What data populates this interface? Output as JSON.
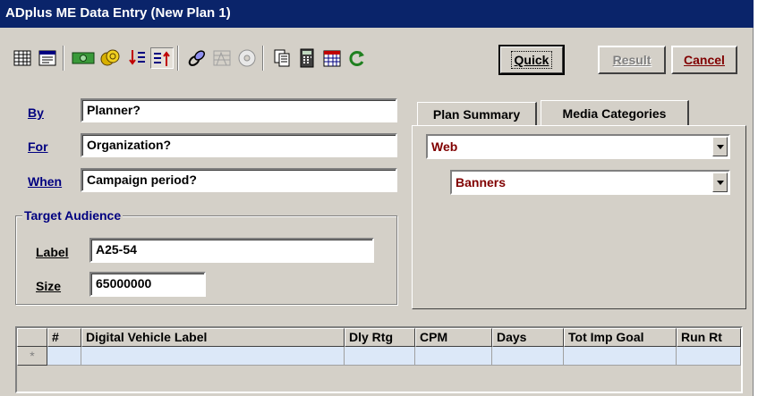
{
  "window": {
    "title": "ADplus ME Data Entry (New Plan 1)"
  },
  "toolbar": {
    "icons": [
      "table-grid-icon",
      "form-view-icon",
      "money-icon",
      "coins-icon",
      "sort-down-icon",
      "sort-up-icon",
      "link-icon",
      "chart-lines-icon",
      "disc-icon",
      "copy-pages-icon",
      "calculator-icon",
      "calendar-icon",
      "refresh-icon"
    ],
    "quick_label": "Quick",
    "result_label": "Result",
    "cancel_label": "Cancel"
  },
  "form": {
    "by_label": "By",
    "by_value": "Planner?",
    "for_label": "For",
    "for_value": "Organization?",
    "when_label": "When",
    "when_value": "Campaign period?"
  },
  "target_audience": {
    "title": "Target Audience",
    "label_label": "Label",
    "label_value": "A25-54",
    "size_label": "Size",
    "size_value": "65000000"
  },
  "tabs": [
    {
      "label": "Plan Summary"
    },
    {
      "label": "Media Categories"
    }
  ],
  "media": {
    "category": "Web",
    "subcategory": "Banners"
  },
  "grid": {
    "columns": [
      "#",
      "Digital Vehicle Label",
      "Dly Rtg",
      "CPM",
      "Days",
      "Tot Imp Goal",
      "Run Rt"
    ],
    "new_row_marker": "*"
  },
  "colors": {
    "title_bar": "#0a246a",
    "label": "#000080",
    "accent": "#800000",
    "grid_row": "#dce8f8"
  }
}
